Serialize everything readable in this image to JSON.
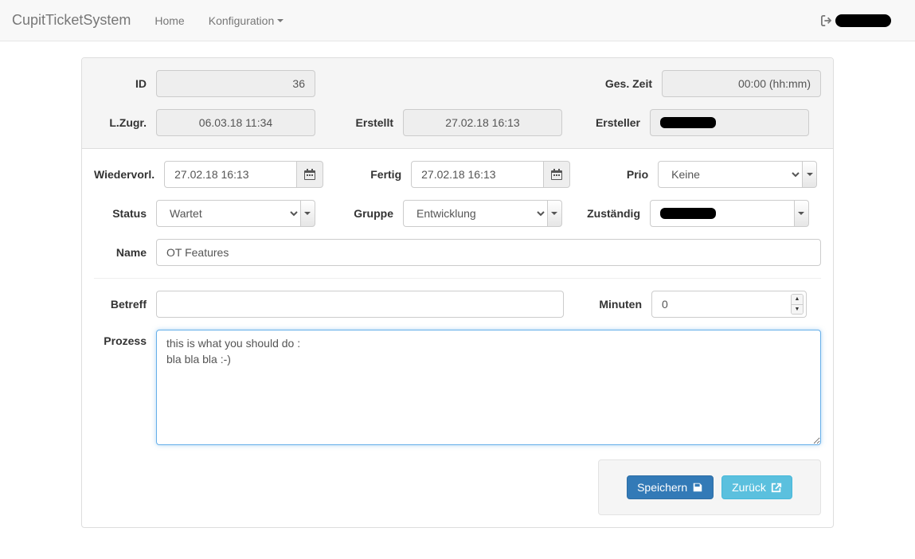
{
  "nav": {
    "brand": "CupitTicketSystem",
    "home": "Home",
    "config": "Konfiguration"
  },
  "labels": {
    "id": "ID",
    "gesZeit": "Ges. Zeit",
    "lZugr": "L.Zugr.",
    "erstellt": "Erstellt",
    "ersteller": "Ersteller",
    "wiedervorl": "Wiedervorl.",
    "fertig": "Fertig",
    "prio": "Prio",
    "status": "Status",
    "gruppe": "Gruppe",
    "zustaendig": "Zuständig",
    "name": "Name",
    "betreff": "Betreff",
    "minuten": "Minuten",
    "prozess": "Prozess"
  },
  "values": {
    "id": "36",
    "gesZeit": "00:00 (hh:mm)",
    "lZugr": "06.03.18 11:34",
    "erstellt": "27.02.18 16:13",
    "wiedervorl": "27.02.18 16:13",
    "fertig": "27.02.18 16:13",
    "prio": "Keine",
    "status": "Wartet",
    "gruppe": "Entwicklung",
    "name": "OT Features",
    "betreff": "",
    "minuten": "0",
    "prozess": "this is what you should do :\nbla bla bla :-)"
  },
  "buttons": {
    "save": "Speichern",
    "back": "Zurück"
  }
}
